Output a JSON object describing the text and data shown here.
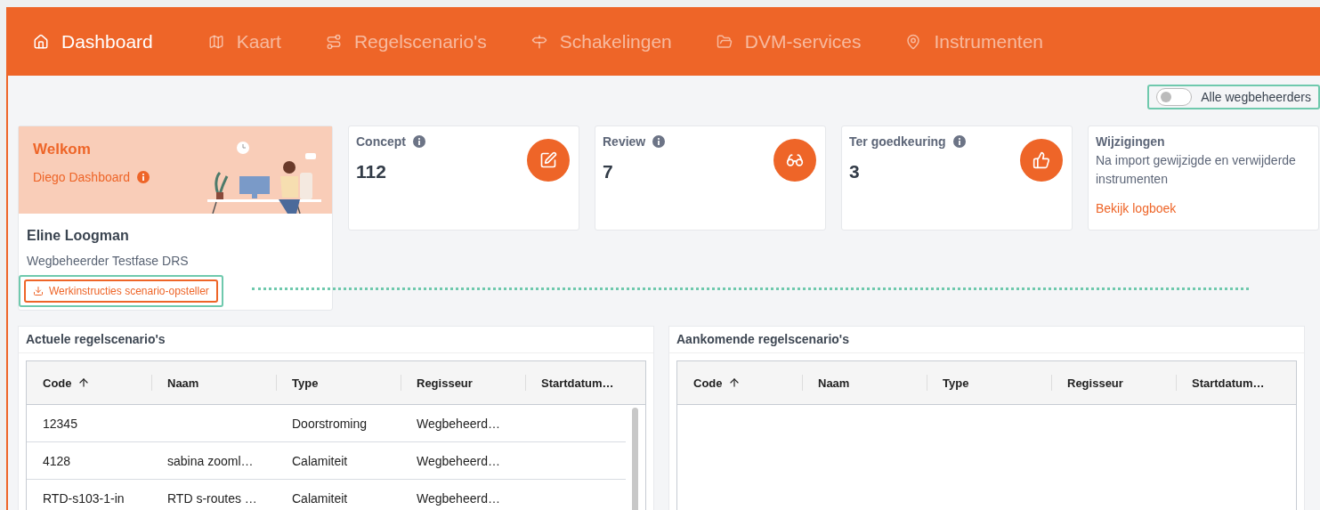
{
  "nav": [
    {
      "label": "Dashboard",
      "selected": true
    },
    {
      "label": "Kaart",
      "selected": false
    },
    {
      "label": "Regelscenario's",
      "selected": false
    },
    {
      "label": "Schakelingen",
      "selected": false
    },
    {
      "label": "DVM-services",
      "selected": false
    },
    {
      "label": "Instrumenten",
      "selected": false
    }
  ],
  "toggle": {
    "label": "Alle wegbeheerders",
    "on": false
  },
  "welcome": {
    "title": "Welkom",
    "subtitle": "Diego Dashboard",
    "name": "Eline Loogman",
    "role": "Wegbeheerder Testfase DRS",
    "button": "Werkinstructies scenario-opsteller"
  },
  "stats": [
    {
      "kind": "count",
      "title": "Concept",
      "value": "112"
    },
    {
      "kind": "count",
      "title": "Review",
      "value": "7"
    },
    {
      "kind": "count",
      "title": "Ter goedkeuring",
      "value": "3"
    },
    {
      "kind": "info",
      "title": "Wijzigingen",
      "text": "Na import gewijzigde en verwijderde instrumenten",
      "link": "Bekijk logboek"
    }
  ],
  "tables": [
    {
      "title": "Actuele regelscenario's",
      "columns": [
        {
          "label": "Code",
          "sorted": true
        },
        {
          "label": "Naam",
          "sorted": false
        },
        {
          "label": "Type",
          "sorted": false
        },
        {
          "label": "Regisseur",
          "sorted": false
        },
        {
          "label": "Startdatum…",
          "sorted": false
        }
      ],
      "rows": [
        [
          "12345",
          "",
          "Doorstroming",
          "Wegbeheerd…",
          ""
        ],
        [
          "4128",
          "sabina zooml…",
          "Calamiteit",
          "Wegbeheerd…",
          ""
        ],
        [
          "RTD-s103-1-in",
          "RTD s-routes …",
          "Calamiteit",
          "Wegbeheerd…",
          ""
        ]
      ]
    },
    {
      "title": "Aankomende regelscenario's",
      "columns": [
        {
          "label": "Code",
          "sorted": true
        },
        {
          "label": "Naam",
          "sorted": false
        },
        {
          "label": "Type",
          "sorted": false
        },
        {
          "label": "Regisseur",
          "sorted": false
        },
        {
          "label": "Startdatum…",
          "sorted": false
        }
      ]
    }
  ]
}
